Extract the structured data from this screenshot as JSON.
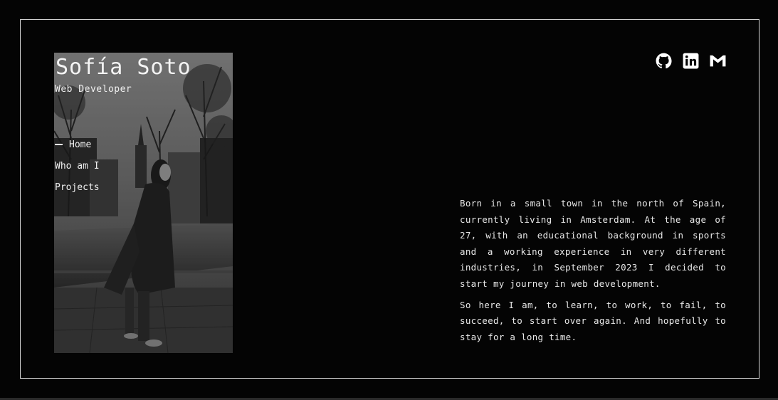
{
  "header": {
    "name": "Sofía Soto",
    "role": "Web Developer"
  },
  "nav": {
    "items": [
      {
        "label": "Home",
        "active": true
      },
      {
        "label": "Who am I",
        "active": false
      },
      {
        "label": "Projects",
        "active": false
      }
    ]
  },
  "socials": [
    {
      "icon": "github-icon"
    },
    {
      "icon": "linkedin-icon"
    },
    {
      "icon": "gmail-icon"
    }
  ],
  "bio": {
    "paragraph_1": "Born in a small town in the north of Spain, currently living in Amsterdam. At the age of 27, with an educational background in sports and a working experience in very different industries, in September 2023 I decided to start my journey in web development.",
    "paragraph_2": "So here I am, to learn, to work, to fail, to succeed, to start over again. And hopefully to stay for a long time."
  },
  "colors": {
    "background": "#040404",
    "frame_border": "#d6d6d6",
    "text": "#ececec"
  }
}
